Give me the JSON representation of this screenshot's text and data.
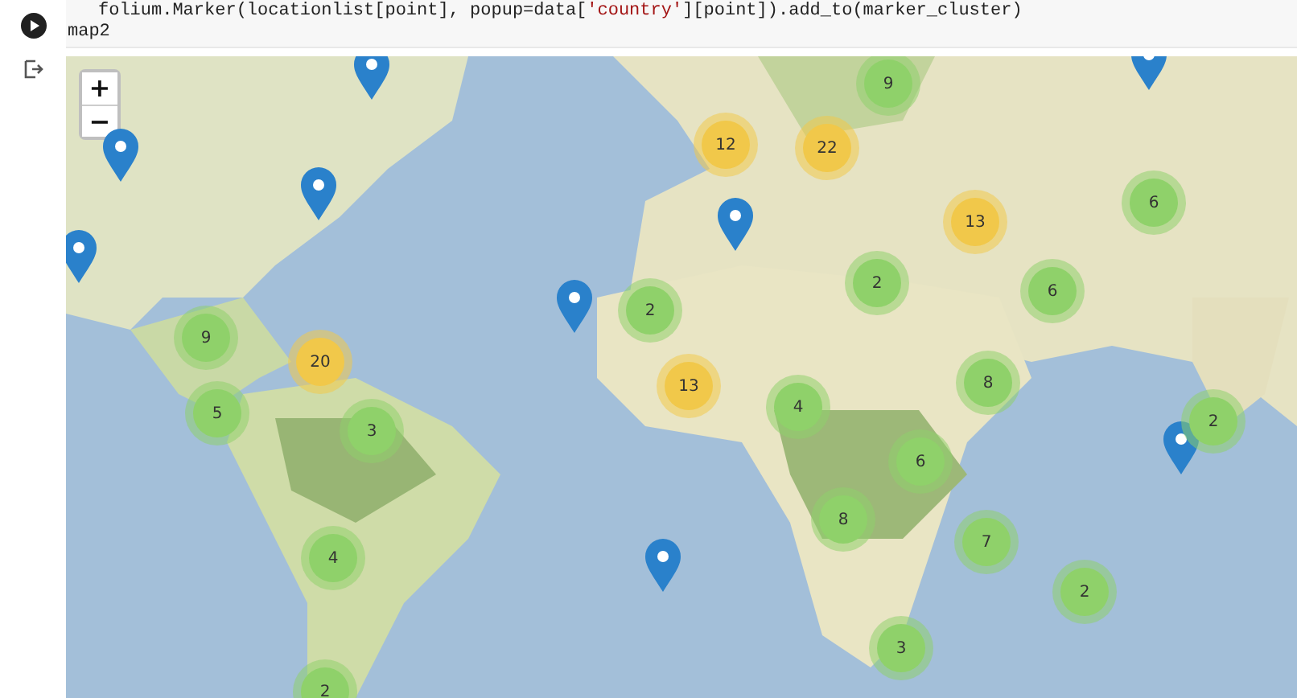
{
  "code_cell": {
    "tokens": [
      {
        "text": "folium.Marker(locationlist[point], popup=data[",
        "kind": "plain"
      },
      {
        "text": "'country'",
        "kind": "string"
      },
      {
        "text": "][point]).add_to(marker_cluster)",
        "kind": "plain"
      }
    ],
    "source": "map2"
  },
  "map": {
    "zoom_in": "+",
    "zoom_out": "−",
    "clusters": [
      {
        "count": "9",
        "color": "#8fd16a"
      },
      {
        "count": "12",
        "color": "#f1c84a"
      },
      {
        "count": "22",
        "color": "#f1c84a"
      },
      {
        "count": "13",
        "color": "#f1c84a"
      },
      {
        "count": "6",
        "color": "#8fd16a"
      },
      {
        "count": "2",
        "color": "#8fd16a"
      },
      {
        "count": "6",
        "color": "#8fd16a"
      },
      {
        "count": "2",
        "color": "#8fd16a"
      },
      {
        "count": "9",
        "color": "#8fd16a"
      },
      {
        "count": "20",
        "color": "#f1c84a"
      },
      {
        "count": "13",
        "color": "#f1c84a"
      },
      {
        "count": "4",
        "color": "#8fd16a"
      },
      {
        "count": "8",
        "color": "#8fd16a"
      },
      {
        "count": "5",
        "color": "#8fd16a"
      },
      {
        "count": "3",
        "color": "#8fd16a"
      },
      {
        "count": "2",
        "color": "#8fd16a"
      },
      {
        "count": "6",
        "color": "#8fd16a"
      },
      {
        "count": "8",
        "color": "#8fd16a"
      },
      {
        "count": "4",
        "color": "#8fd16a"
      },
      {
        "count": "7",
        "color": "#8fd16a"
      },
      {
        "count": "2",
        "color": "#8fd16a"
      },
      {
        "count": "3",
        "color": "#8fd16a"
      },
      {
        "count": "2",
        "color": "#8fd16a"
      }
    ],
    "markers": [
      {
        "kind": "pin"
      },
      {
        "kind": "pin"
      },
      {
        "kind": "pin"
      },
      {
        "kind": "pin"
      },
      {
        "kind": "pin"
      },
      {
        "kind": "pin"
      },
      {
        "kind": "pin"
      },
      {
        "kind": "pin"
      },
      {
        "kind": "pin"
      }
    ]
  }
}
